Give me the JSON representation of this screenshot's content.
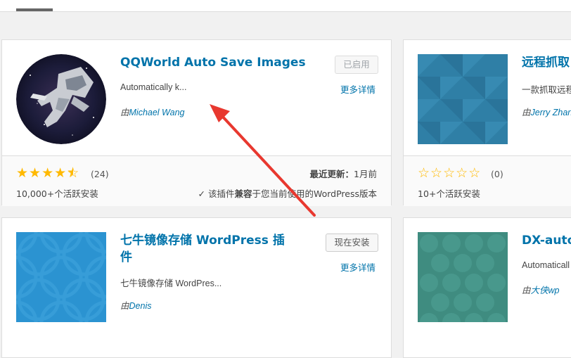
{
  "plugins": [
    {
      "title": "QQWorld Auto Save Images",
      "description": "Automatically k...",
      "author_prefix": "由",
      "author": "Michael Wang",
      "action_label": "已启用",
      "more_details": "更多详情",
      "rating_count": "(24)",
      "stars": 4.5,
      "installs": "10,000+个活跃安装",
      "last_updated_label": "最近更新：",
      "last_updated_value": "1月前",
      "compat_check": "✓",
      "compat_pre": "该插件",
      "compat_bold": "兼容",
      "compat_post": "于您当前使用的WordPress版本"
    },
    {
      "title": "远程抓取",
      "description": "一款抓取远程",
      "author_prefix": "由",
      "author": "Jerry Zhan",
      "rating_count": "(0)",
      "stars": 0,
      "installs": "10+个活跃安装"
    },
    {
      "title": "七牛镜像存储 WordPress 插件",
      "description": "七牛镜像存储 WordPres...",
      "author_prefix": "由",
      "author": "Denis",
      "action_label": "现在安装",
      "more_details": "更多详情"
    },
    {
      "title": "DX-auto",
      "description": "Automaticall",
      "author_prefix": "由",
      "author": "大侠wp"
    }
  ],
  "colors": {
    "link": "#0073aa",
    "star": "#ffb900",
    "annotation_arrow": "#e8382f"
  }
}
